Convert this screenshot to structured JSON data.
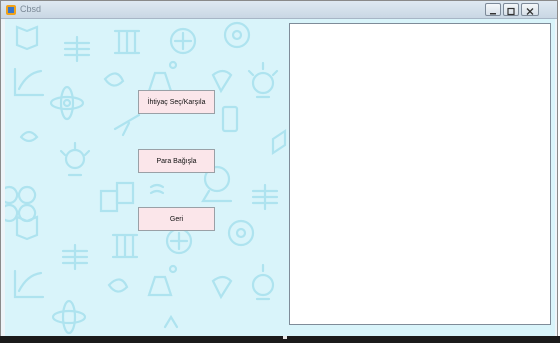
{
  "window": {
    "title": "Cbsd"
  },
  "buttons": {
    "need_select": "İhtiyaç Seç/Karşıla",
    "donate": "Para Bağışla",
    "back": "Geri"
  },
  "colors": {
    "background": "#d9f4fa",
    "pattern": "#aee3ef",
    "button": "#fbe6ea"
  }
}
